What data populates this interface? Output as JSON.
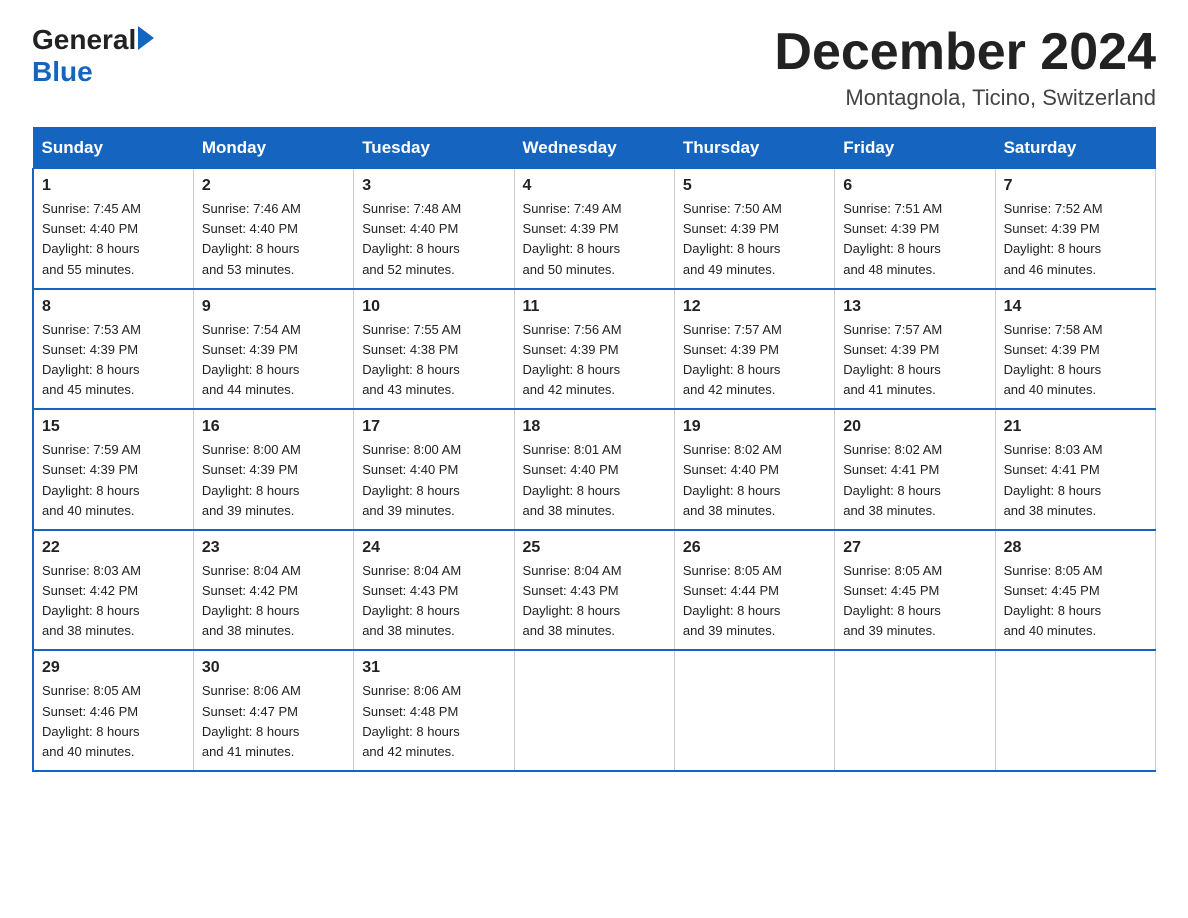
{
  "logo": {
    "general": "General",
    "blue": "Blue"
  },
  "title": "December 2024",
  "subtitle": "Montagnola, Ticino, Switzerland",
  "weekdays": [
    "Sunday",
    "Monday",
    "Tuesday",
    "Wednesday",
    "Thursday",
    "Friday",
    "Saturday"
  ],
  "weeks": [
    [
      {
        "day": "1",
        "sunrise": "7:45 AM",
        "sunset": "4:40 PM",
        "daylight": "8 hours and 55 minutes."
      },
      {
        "day": "2",
        "sunrise": "7:46 AM",
        "sunset": "4:40 PM",
        "daylight": "8 hours and 53 minutes."
      },
      {
        "day": "3",
        "sunrise": "7:48 AM",
        "sunset": "4:40 PM",
        "daylight": "8 hours and 52 minutes."
      },
      {
        "day": "4",
        "sunrise": "7:49 AM",
        "sunset": "4:39 PM",
        "daylight": "8 hours and 50 minutes."
      },
      {
        "day": "5",
        "sunrise": "7:50 AM",
        "sunset": "4:39 PM",
        "daylight": "8 hours and 49 minutes."
      },
      {
        "day": "6",
        "sunrise": "7:51 AM",
        "sunset": "4:39 PM",
        "daylight": "8 hours and 48 minutes."
      },
      {
        "day": "7",
        "sunrise": "7:52 AM",
        "sunset": "4:39 PM",
        "daylight": "8 hours and 46 minutes."
      }
    ],
    [
      {
        "day": "8",
        "sunrise": "7:53 AM",
        "sunset": "4:39 PM",
        "daylight": "8 hours and 45 minutes."
      },
      {
        "day": "9",
        "sunrise": "7:54 AM",
        "sunset": "4:39 PM",
        "daylight": "8 hours and 44 minutes."
      },
      {
        "day": "10",
        "sunrise": "7:55 AM",
        "sunset": "4:38 PM",
        "daylight": "8 hours and 43 minutes."
      },
      {
        "day": "11",
        "sunrise": "7:56 AM",
        "sunset": "4:39 PM",
        "daylight": "8 hours and 42 minutes."
      },
      {
        "day": "12",
        "sunrise": "7:57 AM",
        "sunset": "4:39 PM",
        "daylight": "8 hours and 42 minutes."
      },
      {
        "day": "13",
        "sunrise": "7:57 AM",
        "sunset": "4:39 PM",
        "daylight": "8 hours and 41 minutes."
      },
      {
        "day": "14",
        "sunrise": "7:58 AM",
        "sunset": "4:39 PM",
        "daylight": "8 hours and 40 minutes."
      }
    ],
    [
      {
        "day": "15",
        "sunrise": "7:59 AM",
        "sunset": "4:39 PM",
        "daylight": "8 hours and 40 minutes."
      },
      {
        "day": "16",
        "sunrise": "8:00 AM",
        "sunset": "4:39 PM",
        "daylight": "8 hours and 39 minutes."
      },
      {
        "day": "17",
        "sunrise": "8:00 AM",
        "sunset": "4:40 PM",
        "daylight": "8 hours and 39 minutes."
      },
      {
        "day": "18",
        "sunrise": "8:01 AM",
        "sunset": "4:40 PM",
        "daylight": "8 hours and 38 minutes."
      },
      {
        "day": "19",
        "sunrise": "8:02 AM",
        "sunset": "4:40 PM",
        "daylight": "8 hours and 38 minutes."
      },
      {
        "day": "20",
        "sunrise": "8:02 AM",
        "sunset": "4:41 PM",
        "daylight": "8 hours and 38 minutes."
      },
      {
        "day": "21",
        "sunrise": "8:03 AM",
        "sunset": "4:41 PM",
        "daylight": "8 hours and 38 minutes."
      }
    ],
    [
      {
        "day": "22",
        "sunrise": "8:03 AM",
        "sunset": "4:42 PM",
        "daylight": "8 hours and 38 minutes."
      },
      {
        "day": "23",
        "sunrise": "8:04 AM",
        "sunset": "4:42 PM",
        "daylight": "8 hours and 38 minutes."
      },
      {
        "day": "24",
        "sunrise": "8:04 AM",
        "sunset": "4:43 PM",
        "daylight": "8 hours and 38 minutes."
      },
      {
        "day": "25",
        "sunrise": "8:04 AM",
        "sunset": "4:43 PM",
        "daylight": "8 hours and 38 minutes."
      },
      {
        "day": "26",
        "sunrise": "8:05 AM",
        "sunset": "4:44 PM",
        "daylight": "8 hours and 39 minutes."
      },
      {
        "day": "27",
        "sunrise": "8:05 AM",
        "sunset": "4:45 PM",
        "daylight": "8 hours and 39 minutes."
      },
      {
        "day": "28",
        "sunrise": "8:05 AM",
        "sunset": "4:45 PM",
        "daylight": "8 hours and 40 minutes."
      }
    ],
    [
      {
        "day": "29",
        "sunrise": "8:05 AM",
        "sunset": "4:46 PM",
        "daylight": "8 hours and 40 minutes."
      },
      {
        "day": "30",
        "sunrise": "8:06 AM",
        "sunset": "4:47 PM",
        "daylight": "8 hours and 41 minutes."
      },
      {
        "day": "31",
        "sunrise": "8:06 AM",
        "sunset": "4:48 PM",
        "daylight": "8 hours and 42 minutes."
      },
      null,
      null,
      null,
      null
    ]
  ],
  "labels": {
    "sunrise": "Sunrise:",
    "sunset": "Sunset:",
    "daylight": "Daylight:"
  },
  "colors": {
    "header_bg": "#1565C0",
    "header_text": "#ffffff",
    "border": "#1565C0"
  }
}
